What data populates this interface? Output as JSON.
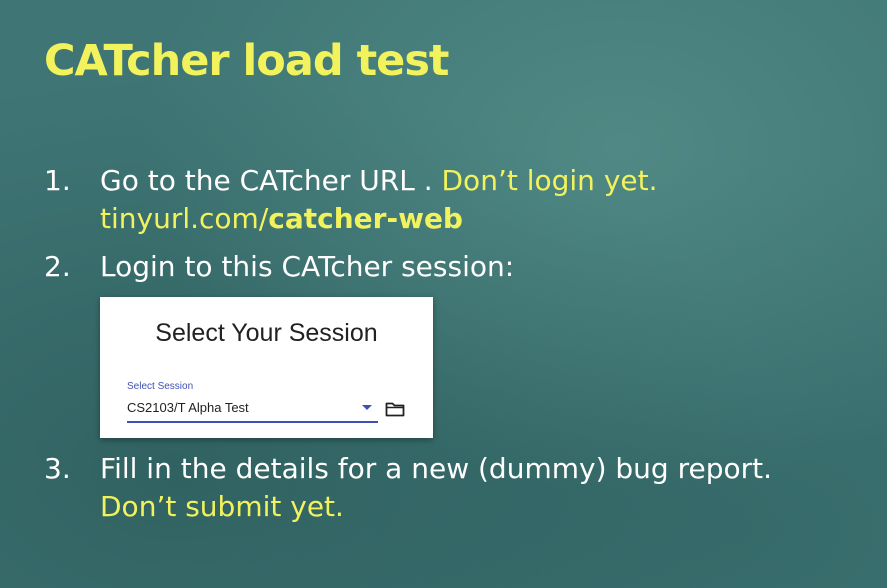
{
  "slide": {
    "title": "CATcher load test",
    "colors": {
      "background": "#3f7675",
      "highlight": "#f2f25c",
      "text": "#ffffff",
      "accent": "#3f51b5"
    },
    "steps": [
      {
        "number": "1.",
        "text": "Go to the CATcher URL . ",
        "highlight": "Don’t login yet.",
        "link_prefix": "tinyurl.com/",
        "link_bold": "catcher-web"
      },
      {
        "number": "2.",
        "text": "Login to this CATcher session:"
      },
      {
        "number": "3.",
        "text": "Fill in the details for a new (dummy) bug report.",
        "highlight": "Don’t submit yet."
      }
    ]
  },
  "session_card": {
    "title": "Select Your Session",
    "field_label": "Select Session",
    "selected_value": "CS2103/T Alpha Test",
    "dropdown_icon": "arrow-drop-down-icon",
    "folder_icon": "folder-icon"
  }
}
